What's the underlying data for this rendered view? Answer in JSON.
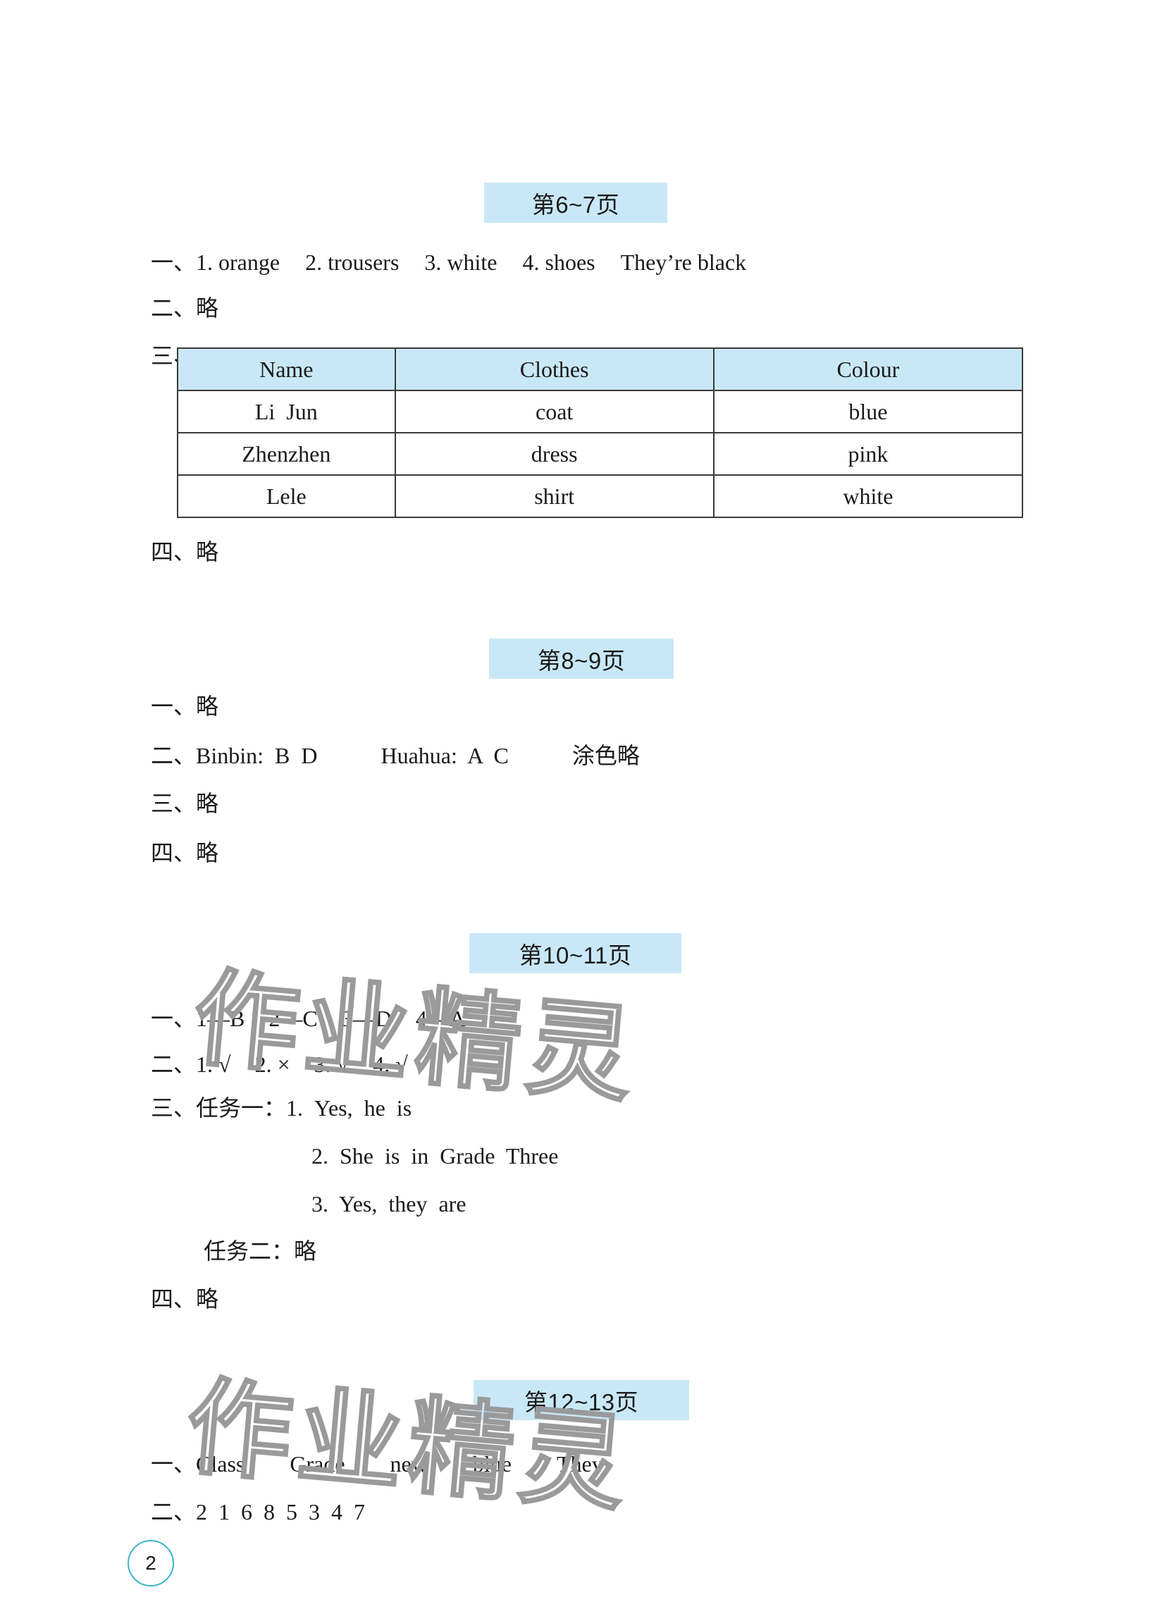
{
  "sections": [
    {
      "header": "第6~7页",
      "items": {
        "s1": {
          "label": "一、",
          "parts": [
            "1. orange",
            "2. trousers",
            "3. white",
            "4. shoes",
            "They’re black"
          ]
        },
        "s2": {
          "label": "二、",
          "text": "略"
        },
        "s3": {
          "label": "三、"
        },
        "s4": {
          "label": "四、",
          "text": "略"
        }
      },
      "table": {
        "headers": [
          "Name",
          "Clothes",
          "Colour"
        ],
        "rows": [
          [
            "Li  Jun",
            "coat",
            "blue"
          ],
          [
            "Zhenzhen",
            "dress",
            "pink"
          ],
          [
            "Lele",
            "shirt",
            "white"
          ]
        ]
      }
    },
    {
      "header": "第8~9页",
      "items": {
        "s1": {
          "label": "一、",
          "text": "略"
        },
        "s2": {
          "label": "二、",
          "binbin": "Binbin:  B  D",
          "huahua": "Huahua:  A  C",
          "note": "涂色略"
        },
        "s3": {
          "label": "三、",
          "text": "略"
        },
        "s4": {
          "label": "四、",
          "text": "略"
        }
      }
    },
    {
      "header": "第10~11页",
      "items": {
        "s1": {
          "label": "一、",
          "parts": [
            "1—B",
            "2—C",
            "3—D",
            "4—A"
          ]
        },
        "s2": {
          "label": "二、",
          "parts": [
            "1. √",
            "2. ×",
            "3. √",
            "4. √"
          ]
        },
        "s3": {
          "label": "三、",
          "task1_label": "任务一：",
          "task1": [
            "1.  Yes,  he  is",
            "2.  She  is  in  Grade  Three",
            "3.  Yes,  they  are"
          ],
          "task2_label": "任务二：",
          "task2": "略"
        },
        "s4": {
          "label": "四、",
          "text": "略"
        }
      }
    },
    {
      "header": "第12~13页",
      "items": {
        "s1": {
          "label": "一、",
          "parts": [
            "Class",
            "Grade",
            "new",
            "blue",
            "They"
          ]
        },
        "s2": {
          "label": "二、",
          "text": "2  1  6  8  5  3  4  7"
        }
      }
    }
  ],
  "watermark": "作业精灵",
  "page_number": "2",
  "colors": {
    "header_bg": "#c9e8f7",
    "page_circle": "#3cb5c8"
  }
}
